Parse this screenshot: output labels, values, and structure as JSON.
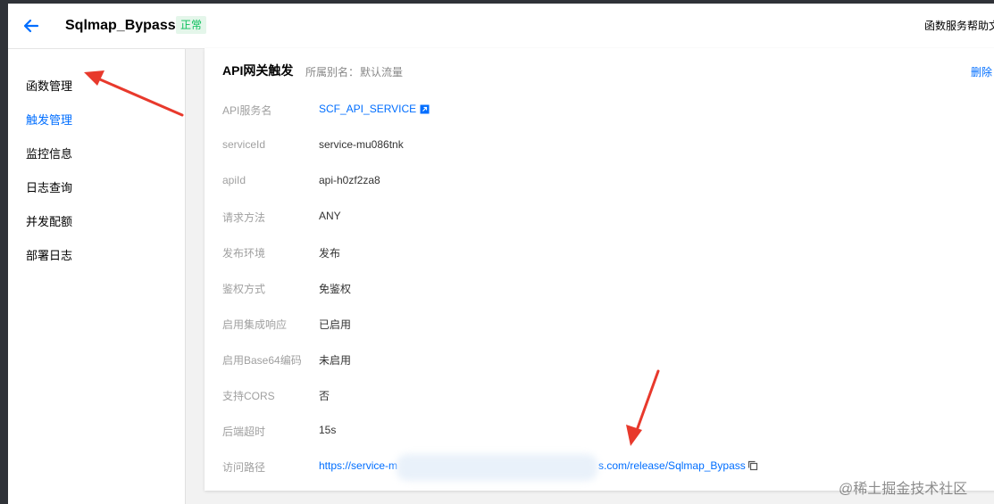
{
  "header": {
    "title": "Sqlmap_Bypass",
    "status": "正常",
    "help_link": "函数服务帮助文"
  },
  "sidebar": {
    "items": [
      {
        "label": "函数管理",
        "active": false
      },
      {
        "label": "触发管理",
        "active": true
      },
      {
        "label": "监控信息",
        "active": false
      },
      {
        "label": "日志查询",
        "active": false
      },
      {
        "label": "并发配额",
        "active": false
      },
      {
        "label": "部署日志",
        "active": false
      }
    ]
  },
  "card": {
    "title": "API网关触发",
    "alias_label": "所属别名：",
    "alias_value": "默认流量",
    "delete_label": "删除",
    "rows": [
      {
        "label": "API服务名",
        "value": "SCF_API_SERVICE"
      },
      {
        "label": "serviceId",
        "value": "service-mu086tnk"
      },
      {
        "label": "apiId",
        "value": "api-h0zf2za8"
      },
      {
        "label": "请求方法",
        "value": "ANY"
      },
      {
        "label": "发布环境",
        "value": "发布"
      },
      {
        "label": "鉴权方式",
        "value": "免鉴权"
      },
      {
        "label": "启用集成响应",
        "value": "已启用"
      },
      {
        "label": "启用Base64编码",
        "value": "未启用"
      },
      {
        "label": "支持CORS",
        "value": "否"
      },
      {
        "label": "后端超时",
        "value": "15s"
      },
      {
        "label": "访问路径",
        "value_prefix": "https://service-m",
        "value_suffix": "s.com/release/Sqlmap_Bypass"
      }
    ]
  },
  "watermark": "@稀土掘金技术社区",
  "colors": {
    "accent": "#006eff",
    "status_text": "#0abf5b",
    "status_bg": "#e4f6ea",
    "annotation_arrow": "#e8392c"
  },
  "icons": {
    "back": "arrow-left-icon",
    "external_link": "external-link-icon",
    "copy": "copy-icon"
  }
}
